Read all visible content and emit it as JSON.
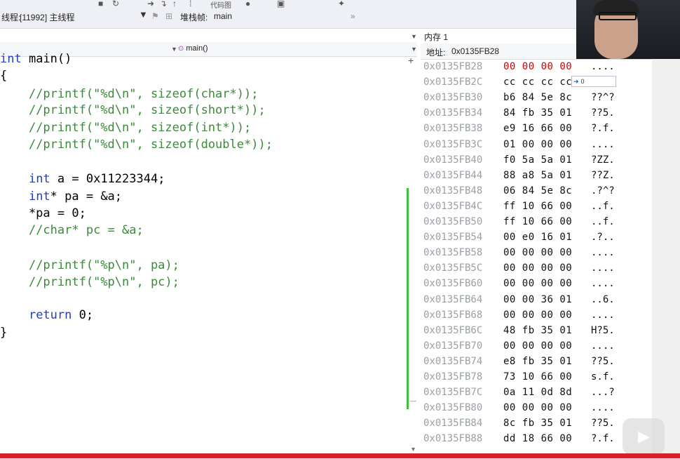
{
  "toolbar": {
    "thread_label": "线程:",
    "thread_value": "[11992] 主线程",
    "stackframe_label": "堆栈帧:",
    "stackframe_value": "main",
    "tab_partial": "代码图"
  },
  "nav": {
    "function": "main()"
  },
  "code": {
    "lines": [
      {
        "parts": [
          {
            "t": "int",
            "c": "kw"
          },
          {
            "t": " main()"
          }
        ]
      },
      {
        "parts": [
          {
            "t": "{"
          }
        ]
      },
      {
        "parts": [
          {
            "t": "    "
          },
          {
            "t": "//printf(\"%d\\n\", sizeof(char*));",
            "c": "cm"
          }
        ]
      },
      {
        "parts": [
          {
            "t": "    "
          },
          {
            "t": "//printf(\"%d\\n\", sizeof(short*));",
            "c": "cm"
          }
        ]
      },
      {
        "parts": [
          {
            "t": "    "
          },
          {
            "t": "//printf(\"%d\\n\", sizeof(int*));",
            "c": "cm"
          }
        ]
      },
      {
        "parts": [
          {
            "t": "    "
          },
          {
            "t": "//printf(\"%d\\n\", sizeof(double*));",
            "c": "cm"
          }
        ]
      },
      {
        "parts": [
          {
            "t": ""
          }
        ]
      },
      {
        "parts": [
          {
            "t": "    "
          },
          {
            "t": "int",
            "c": "kw"
          },
          {
            "t": " a = 0x11223344;"
          }
        ]
      },
      {
        "parts": [
          {
            "t": "    "
          },
          {
            "t": "int",
            "c": "kw"
          },
          {
            "t": "* pa = &a;"
          }
        ]
      },
      {
        "parts": [
          {
            "t": "    *pa = 0;"
          }
        ]
      },
      {
        "parts": [
          {
            "t": "    "
          },
          {
            "t": "//char* pc = &a;",
            "c": "cm"
          }
        ]
      },
      {
        "parts": [
          {
            "t": ""
          }
        ]
      },
      {
        "parts": [
          {
            "t": "    "
          },
          {
            "t": "//printf(\"%p\\n\", pa);",
            "c": "cm"
          }
        ]
      },
      {
        "parts": [
          {
            "t": "    "
          },
          {
            "t": "//printf(\"%p\\n\", pc);",
            "c": "cm"
          }
        ]
      },
      {
        "parts": [
          {
            "t": ""
          }
        ]
      },
      {
        "parts": [
          {
            "t": "    "
          },
          {
            "t": "return",
            "c": "kw"
          },
          {
            "t": " 0;"
          }
        ]
      },
      {
        "parts": [
          {
            "t": "}"
          }
        ]
      }
    ]
  },
  "memory": {
    "title": "内存 1",
    "address_label": "地址:",
    "address_value": "0x0135FB28",
    "tooltip_value": "0",
    "rows": [
      {
        "addr": "0x0135FB28",
        "bytes": "00 00 00 00",
        "ascii": "....",
        "changed": true
      },
      {
        "addr": "0x0135FB2C",
        "bytes": "cc cc cc cc",
        "ascii": "???",
        "changed": false
      },
      {
        "addr": "0x0135FB30",
        "bytes": "b6 84 5e 8c",
        "ascii": "??^?",
        "changed": false
      },
      {
        "addr": "0x0135FB34",
        "bytes": "84 fb 35 01",
        "ascii": "??5.",
        "changed": false
      },
      {
        "addr": "0x0135FB38",
        "bytes": "e9 16 66 00",
        "ascii": "?.f.",
        "changed": false
      },
      {
        "addr": "0x0135FB3C",
        "bytes": "01 00 00 00",
        "ascii": "....",
        "changed": false
      },
      {
        "addr": "0x0135FB40",
        "bytes": "f0 5a 5a 01",
        "ascii": "?ZZ.",
        "changed": false
      },
      {
        "addr": "0x0135FB44",
        "bytes": "88 a8 5a 01",
        "ascii": "??Z.",
        "changed": false
      },
      {
        "addr": "0x0135FB48",
        "bytes": "06 84 5e 8c",
        "ascii": ".?^?",
        "changed": false
      },
      {
        "addr": "0x0135FB4C",
        "bytes": "ff 10 66 00",
        "ascii": "..f.",
        "changed": false
      },
      {
        "addr": "0x0135FB50",
        "bytes": "ff 10 66 00",
        "ascii": "..f.",
        "changed": false
      },
      {
        "addr": "0x0135FB54",
        "bytes": "00 e0 16 01",
        "ascii": ".?..",
        "changed": false
      },
      {
        "addr": "0x0135FB58",
        "bytes": "00 00 00 00",
        "ascii": "....",
        "changed": false
      },
      {
        "addr": "0x0135FB5C",
        "bytes": "00 00 00 00",
        "ascii": "....",
        "changed": false
      },
      {
        "addr": "0x0135FB60",
        "bytes": "00 00 00 00",
        "ascii": "....",
        "changed": false
      },
      {
        "addr": "0x0135FB64",
        "bytes": "00 00 36 01",
        "ascii": "..6.",
        "changed": false
      },
      {
        "addr": "0x0135FB68",
        "bytes": "00 00 00 00",
        "ascii": "....",
        "changed": false
      },
      {
        "addr": "0x0135FB6C",
        "bytes": "48 fb 35 01",
        "ascii": "H?5.",
        "changed": false
      },
      {
        "addr": "0x0135FB70",
        "bytes": "00 00 00 00",
        "ascii": "....",
        "changed": false
      },
      {
        "addr": "0x0135FB74",
        "bytes": "e8 fb 35 01",
        "ascii": "??5.",
        "changed": false
      },
      {
        "addr": "0x0135FB78",
        "bytes": "73 10 66 00",
        "ascii": "s.f.",
        "changed": false
      },
      {
        "addr": "0x0135FB7C",
        "bytes": "0a 11 0d 8d",
        "ascii": "...?",
        "changed": false
      },
      {
        "addr": "0x0135FB80",
        "bytes": "00 00 00 00",
        "ascii": "....",
        "changed": false
      },
      {
        "addr": "0x0135FB84",
        "bytes": "8c fb 35 01",
        "ascii": "??5.",
        "changed": false
      },
      {
        "addr": "0x0135FB88",
        "bytes": "dd 18 66 00",
        "ascii": "?.f.",
        "changed": false
      }
    ]
  }
}
